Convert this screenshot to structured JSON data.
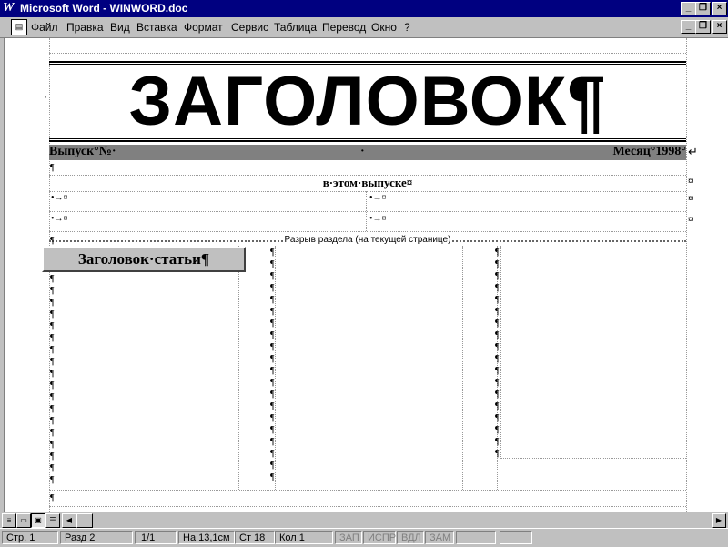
{
  "window": {
    "title": "Microsoft Word - WINWORD.doc",
    "app_icon": "W",
    "buttons": {
      "minimize": "_",
      "restore": "❐",
      "close": "×"
    }
  },
  "menu": {
    "items": [
      "Файл",
      "Правка",
      "Вид",
      "Вставка",
      "Формат",
      "Сервис",
      "Таблица",
      "Перевод",
      "Окно",
      "?"
    ],
    "doc_buttons": {
      "minimize": "_",
      "restore": "❐",
      "close": "×"
    }
  },
  "document": {
    "title": "ЗАГОЛОВОК¶",
    "issue_left": "Выпуск°№·",
    "issue_mid": "·",
    "issue_right": "Месяц°1998°",
    "issue_end": "↵",
    "in_issue_heading": "в·этом·выпуске¤",
    "cell_marker": "¤",
    "table_bullets": [
      "•→¤",
      "•→¤",
      "•→¤",
      "•→¤"
    ],
    "section_break": "Разрыв раздела (на текущей странице)",
    "article_heading": "Заголовок·статьи¶",
    "para_mark": "¶",
    "left_dot": "·"
  },
  "statusbar": {
    "page": "Стр. 1",
    "section": "Разд 2",
    "pages": "1/1",
    "position": "На 13,1см",
    "line": "Ст 18",
    "column": "Кол 1",
    "rec": "ЗАП",
    "trk": "ИСПР",
    "ext": "ВДЛ",
    "ovr": "ЗАМ"
  }
}
